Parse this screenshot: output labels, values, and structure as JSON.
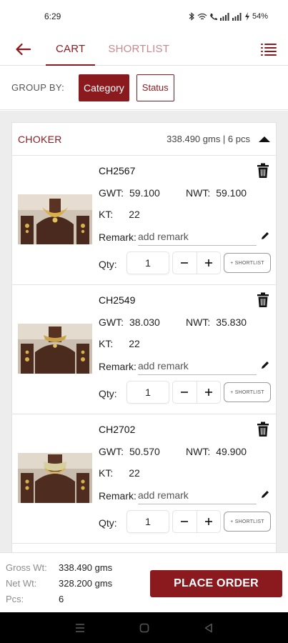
{
  "status_bar": {
    "time": "6:29",
    "battery": "54%"
  },
  "header": {
    "tabs": [
      {
        "label": "CART"
      },
      {
        "label": "SHORTLIST"
      }
    ]
  },
  "groupby": {
    "label": "GROUP BY:",
    "options": [
      {
        "label": "Category"
      },
      {
        "label": "Status"
      }
    ]
  },
  "group": {
    "title": "CHOKER",
    "summary": "338.490 gms | 6 pcs"
  },
  "labels": {
    "gwt": "GWT:",
    "nwt": "NWT:",
    "kt": "KT:",
    "remark": "Remark:",
    "remark_placeholder": "add remark",
    "qty": "Qty:",
    "shortlist_btn": "+ SHORTLIST"
  },
  "items": [
    {
      "code": "CH2567",
      "gwt": "59.100",
      "nwt": "59.100",
      "kt": "22",
      "qty": "1"
    },
    {
      "code": "CH2549",
      "gwt": "38.030",
      "nwt": "35.830",
      "kt": "22",
      "qty": "1"
    },
    {
      "code": "CH2702",
      "gwt": "50.570",
      "nwt": "49.900",
      "kt": "22",
      "qty": "1"
    }
  ],
  "footer": {
    "gross_label": "Gross Wt:",
    "gross_value": "338.490 gms",
    "net_label": "Net Wt:",
    "net_value": "328.200 gms",
    "pcs_label": "Pcs:",
    "pcs_value": "6",
    "place_order": "PLACE ORDER"
  },
  "colors": {
    "brand": "#8b1a1f",
    "background": "#ededed"
  },
  "icons": [
    "back-arrow-icon",
    "menu-icon",
    "trash-icon",
    "pencil-icon",
    "caret-up-icon",
    "minus-icon",
    "plus-icon"
  ]
}
